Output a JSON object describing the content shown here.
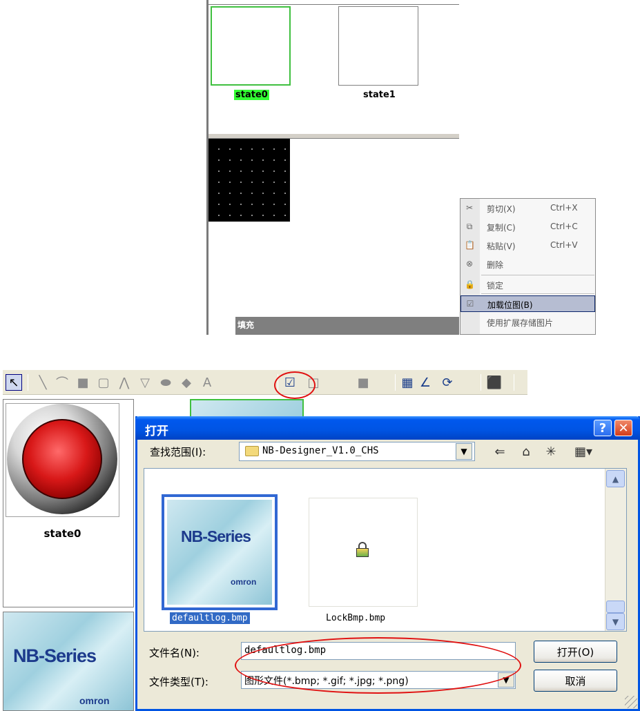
{
  "top_panel": {
    "state0_label": "state0",
    "state1_label": "state1",
    "strip_label": "填充",
    "context_menu": {
      "items": [
        {
          "label": "剪切(X)",
          "shortcut": "Ctrl+X",
          "icon": "scissors-icon",
          "glyph": "✂"
        },
        {
          "label": "复制(C)",
          "shortcut": "Ctrl+C",
          "icon": "copy-icon",
          "glyph": "⧉"
        },
        {
          "label": "粘贴(V)",
          "shortcut": "Ctrl+V",
          "icon": "paste-icon",
          "glyph": "📋"
        },
        {
          "label": "删除",
          "shortcut": "",
          "icon": "delete-icon",
          "glyph": "⊗"
        },
        {
          "label": "锁定",
          "shortcut": "",
          "icon": "lock-icon",
          "glyph": "🔒"
        },
        {
          "label": "加载位图(B)",
          "shortcut": "",
          "icon": "load-bitmap-icon",
          "glyph": "☑"
        },
        {
          "label": "使用扩展存储图片",
          "shortcut": "",
          "icon": "",
          "glyph": ""
        }
      ]
    }
  },
  "toolbar": {
    "tools": [
      {
        "name": "select-arrow-icon",
        "glyph": "↖",
        "active": true
      },
      {
        "name": "line-icon",
        "glyph": "╲"
      },
      {
        "name": "arc-icon",
        "glyph": "⌒"
      },
      {
        "name": "rectangle-icon",
        "glyph": "■"
      },
      {
        "name": "rounded-rect-icon",
        "glyph": "▢"
      },
      {
        "name": "polyline-icon",
        "glyph": "⋀"
      },
      {
        "name": "polygon-icon",
        "glyph": "▽"
      },
      {
        "name": "ellipse-icon",
        "glyph": "⬬"
      },
      {
        "name": "diamond-icon",
        "glyph": "◆"
      },
      {
        "name": "text-icon",
        "glyph": "A"
      },
      {
        "name": "bitmap-icon",
        "glyph": "☑"
      },
      {
        "name": "border-color-icon",
        "glyph": "□"
      },
      {
        "name": "fill-color-icon",
        "glyph": "■"
      },
      {
        "name": "grid-icon",
        "glyph": "▦"
      },
      {
        "name": "angle-icon",
        "glyph": "∠"
      },
      {
        "name": "refresh-icon",
        "glyph": "⟳"
      },
      {
        "name": "fit-screen-icon",
        "glyph": "⬛"
      }
    ]
  },
  "left_panel": {
    "state_label": "state0",
    "thumb_title": "NB-Series",
    "thumb_brand": "omron"
  },
  "dialog": {
    "title": "打开",
    "help_glyph": "?",
    "close_glyph": "✕",
    "lookin_label": "查找范围(I):",
    "lookin_value": "NB-Designer_V1.0_CHS",
    "files": [
      {
        "name": "defaultlog.bmp",
        "thumb_title": "NB-Series",
        "thumb_brand": "omron",
        "selected": true
      },
      {
        "name": "LockBmp.bmp",
        "selected": false
      }
    ],
    "filename_label": "文件名(N):",
    "filename_value": "defaultlog.bmp",
    "filetype_label": "文件类型(T):",
    "filetype_value": "图形文件(*.bmp; *.gif; *.jpg; *.png)",
    "open_button": "打开(O)",
    "cancel_button": "取消"
  },
  "colors": {
    "highlight_red": "#e01010",
    "xp_blue": "#0054e3",
    "selection_green": "#33ff33"
  }
}
